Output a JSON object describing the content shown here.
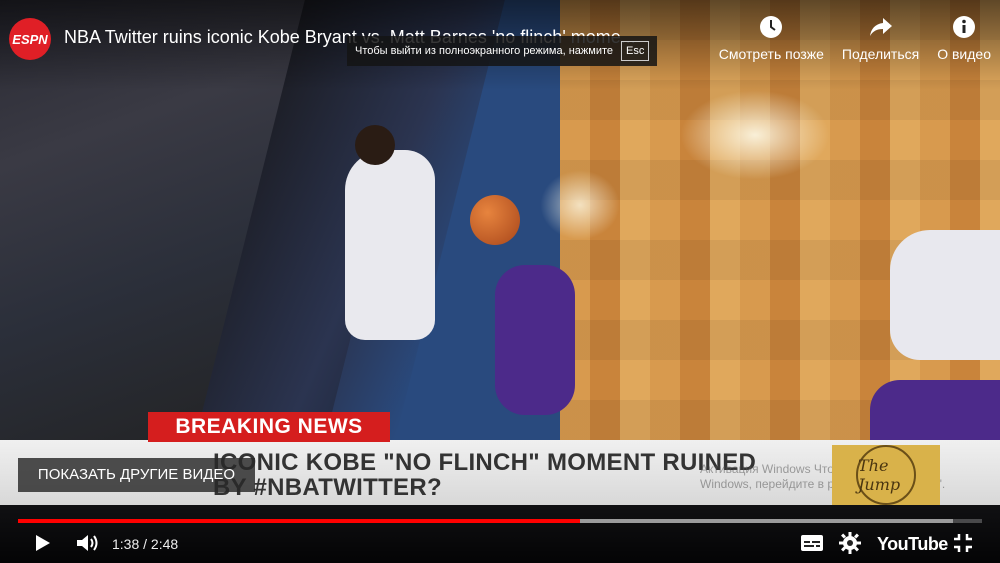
{
  "video": {
    "channel_logo": "ESPN",
    "title": "NBA Twitter ruins iconic Kobe Bryant vs. Matt Barnes 'no flinch' mome..."
  },
  "fullscreen_tip": {
    "text": "Чтобы выйти из полноэкранного режима, нажмите",
    "key": "Esc"
  },
  "top_actions": [
    {
      "icon": "clock-icon",
      "label": "Смотреть позже"
    },
    {
      "icon": "share-icon",
      "label": "Поделиться"
    },
    {
      "icon": "info-icon",
      "label": "О видео"
    }
  ],
  "broadcast": {
    "breaking": "BREAKING NEWS",
    "headline_line1": "ICONIC KOBE \"NO FLINCH\" MOMENT RUINED",
    "headline_line2": "BY #NBATWITTER?",
    "show_logo": "The Jump",
    "watermark": "Активация Windows Чтобы активировать Windows, перейдите в раздел \"Параметры\"."
  },
  "more_videos": "ПОКАЗАТЬ ДРУГИЕ ВИДЕО",
  "player": {
    "current_time": "1:38",
    "duration": "2:48",
    "time_display": "1:38 / 2:48",
    "progress_played": 0.583,
    "progress_loaded": 0.97,
    "brand": "YouTube",
    "accent_color": "#ff0000"
  }
}
